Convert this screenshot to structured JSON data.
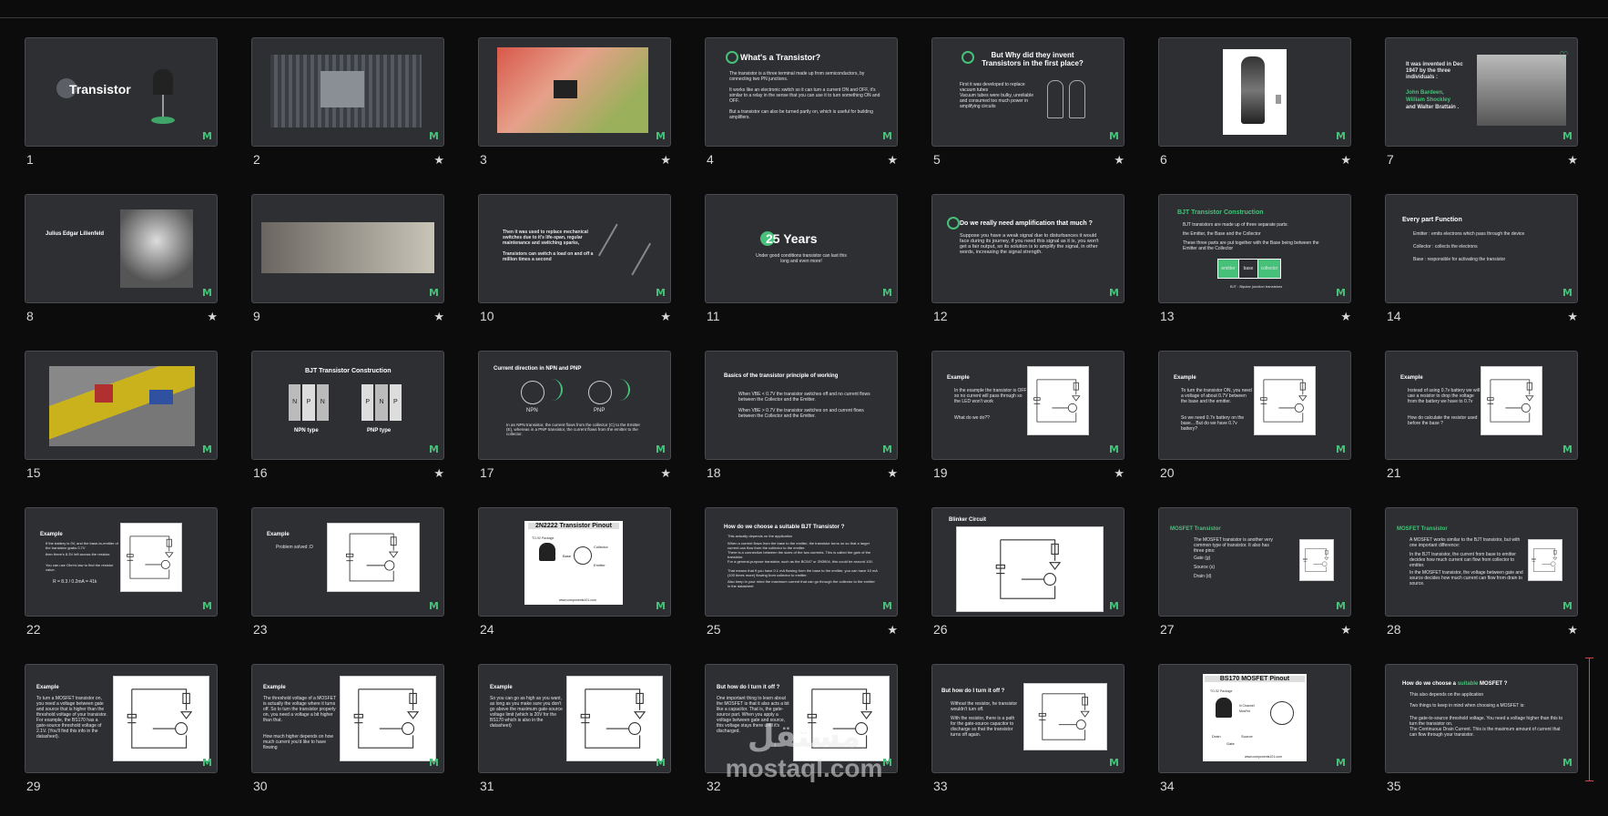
{
  "slides": [
    {
      "n": "1",
      "starred": false,
      "title": "Transistor"
    },
    {
      "n": "2",
      "starred": true
    },
    {
      "n": "3",
      "starred": true
    },
    {
      "n": "4",
      "starred": true,
      "title": "What's a Transistor?",
      "lines": [
        "The transistor is a three terminal made up from semiconductors, by connecting two PN junctions.",
        "It works like an electronic switch so it can turn a current ON and OFF, it's similar to a relay in the sense that you can use it to turn something ON and OFF.",
        "But a transistor can also be turned partly on, which is useful for building amplifiers."
      ]
    },
    {
      "n": "5",
      "starred": true,
      "title": "But Why did they invent Transistors in the first place?",
      "lines": [
        "First it was developed to replace vacuum tubes",
        "Vacuum tubes were bulky, unreliable and consumed too much power in amplifying circuits"
      ]
    },
    {
      "n": "6",
      "starred": true
    },
    {
      "n": "7",
      "starred": true,
      "lines": [
        "It was invented in Dec 1947 by the three individuals :",
        "John Bardeen,",
        "William Shockley",
        "and Walter Brattain ."
      ]
    },
    {
      "n": "8",
      "starred": true,
      "title": "Julius Edgar Lilienfeld"
    },
    {
      "n": "9",
      "starred": true
    },
    {
      "n": "10",
      "starred": true,
      "lines": [
        "Then it was used to replace mechanical switches due to it's life-span, regular maintenance and switching sparks, ",
        "Transistors can switch a load on and off a million times a second"
      ]
    },
    {
      "n": "11",
      "starred": false,
      "title": "25 Years",
      "lines": [
        "Under good conditions transistor can last this long and even more!"
      ]
    },
    {
      "n": "12",
      "starred": false,
      "title": "Do we really need amplification that much ?",
      "lines": [
        "Suppose you have a weak signal due to disturbances it would face during its journey, if you need this signal as it is, you won't get a fair output, so its solution is to amplify the signal, in other words, increasing the signal strength."
      ]
    },
    {
      "n": "13",
      "starred": true,
      "title": "BJT Transistor Construction",
      "lines": [
        "BJT transistors are made up of three separate parts:",
        "the Emitter, the Base and the Collector",
        "These three parts are put together with the Base being between the Emitter and the Collector",
        "emitter",
        "base",
        "collector",
        "BJT : Bipolar junction transistors"
      ]
    },
    {
      "n": "14",
      "starred": true,
      "title": "Every part Function",
      "lines": [
        "Emitter : emits electrons which pass through the device",
        "Collector : collects the electrons",
        "Base : responsible for activating the transistor"
      ]
    },
    {
      "n": "15",
      "starred": false
    },
    {
      "n": "16",
      "starred": true,
      "title": "BJT Transistor Construction",
      "lines": [
        "NPN type",
        "PNP type"
      ]
    },
    {
      "n": "17",
      "starred": true,
      "title": "Current direction in NPN and PNP",
      "lines": [
        "NPN",
        "PNP",
        "In an NPN transistor, the current flows from the collector (C) to the Emitter (E), whereas in a PNP transistor, the current flows from the emitter to the collector."
      ]
    },
    {
      "n": "18",
      "starred": true,
      "title": "Basics of the transistor principle of working",
      "lines": [
        "When VBE < 0.7V the transistor switches off and no current flows between the Collector and the Emitter.",
        "When VBE > 0.7V the transistor switches on and current flows between the Collector and the Emitter."
      ]
    },
    {
      "n": "19",
      "starred": true,
      "title": "Example",
      "lines": [
        "In the example the transistor is OFF so no current will pass through so the LED won't work",
        "What do we do??"
      ]
    },
    {
      "n": "20",
      "starred": false,
      "title": "Example",
      "lines": [
        "To turn the transistor ON, you need a voltage of about 0.7V between the base and the emitter.",
        "So we need 0.7v battery on the base... But do we have 0.7v battery?"
      ]
    },
    {
      "n": "21",
      "starred": false,
      "title": "Example",
      "lines": [
        "Instead of using 0.7v battery we will use a resistor to drop the voltage from the battery we have to 0.7v",
        "How do calculate the resistor used before the base ?"
      ]
    },
    {
      "n": "22",
      "starred": false,
      "title": "Example",
      "lines": [
        "If the battery is 9V, and the base-to-emitter of the transistor grabs 0.7V",
        "then there's 8.3V left across the resistor.",
        "You can use Ohm's law to find the resistor value.",
        "R = 8.3 / 0.2mA = 41k"
      ]
    },
    {
      "n": "23",
      "starred": false,
      "title": "Example",
      "lines": [
        "Problem solved :D"
      ]
    },
    {
      "n": "24",
      "starred": false,
      "title": "2N2222 Transistor Pinout",
      "lines": [
        "TO-92 Package",
        "Collector",
        "Base",
        "Emitter",
        "www.components101.com"
      ]
    },
    {
      "n": "25",
      "starred": true,
      "title": "How do we choose a suitable BJT Transistor ?",
      "lines": [
        "This actually depends on the application",
        "When a current flows from the base to the emitter, the transistor turns on so that a larger current can flow from the collector to the emitter.",
        "There is a connection between the sizes of the two currents. This is called the gain of the transistor.",
        "For a general-purpose transistor, such as the BC547 or 2N3904, this could be around 100.",
        "That means that if you have 0.1 mA flowing from the base to the emitter, you can have 10 mA (100 times more) flowing from collector to emitter.",
        "Also keep in your mind the maximum current that can go through the collector to the emitter in the datasheet"
      ]
    },
    {
      "n": "26",
      "starred": false,
      "title": "Blinker Circuit"
    },
    {
      "n": "27",
      "starred": true,
      "title": "MOSFET Transistor",
      "lines": [
        "The MOSFET transistor is another very common type of transistor. It also has three pins:",
        "Gate (g)",
        "Source (s)",
        "Drain (d)"
      ]
    },
    {
      "n": "28",
      "starred": true,
      "title": "MOSFET Transistor",
      "lines": [
        "A MOSFET works similar to the BJT transistor, but with one important difference:",
        "In the BJT transistor, the current from base to emitter decides how much current can flow from collector to emitter.",
        "In the MOSFET transistor, the voltage between gate and source decides how much current can flow from drain to source."
      ]
    },
    {
      "n": "29",
      "starred": false,
      "title": "Example",
      "lines": [
        "To turn a MOSFET transistor on, you need a voltage between gate and source that is higher than the threshold voltage of your transistor. For example, the BS170 has a gate-source threshold voltage of 2.1V. (You'll find this info in the datasheet)."
      ]
    },
    {
      "n": "30",
      "starred": false,
      "title": "Example",
      "lines": [
        "The threshold voltage of a MOSFET is actually the voltage where it turns off. So to turn the transistor properly on, you need a voltage a bit higher than that.",
        "How much higher depends on how much current you'd like to have flowing"
      ]
    },
    {
      "n": "31",
      "starred": false,
      "title": "Example",
      "lines": [
        "So you can go as high as you want, as long as you make sure you don't go above the maximum gate-source voltage limit (which is 20V for the BS170 which is also in the datasheet)"
      ]
    },
    {
      "n": "32",
      "starred": false,
      "title": "But how do I turn it off ?",
      "lines": [
        "One important thing to learn about the MOSFET is that it also acts a bit like a capacitor. That is, the gate-source part. When you apply a voltage between gate and source, this voltage stays there until it's discharged."
      ]
    },
    {
      "n": "33",
      "starred": false,
      "title": "But how do I turn it off ?",
      "lines": [
        "Without the resistor, he transistor wouldn't turn off.",
        "With the resistor, there is a path for the gate-source capacitor to discharge so that the transistor turns off again."
      ]
    },
    {
      "n": "34",
      "starred": false,
      "title": "BS170 MOSFET Pinout",
      "lines": [
        "TO-92 Package",
        "N Channel MosFet",
        "Drain",
        "Gate",
        "Source",
        "www.components101.com"
      ]
    },
    {
      "n": "35",
      "starred": false,
      "title": "How do we choose a suitable MOSFET ?",
      "lines": [
        "This also depends on the application",
        "Two things to keep in mind when choosing a MOSFET is:",
        "The gate-to-source threshold voltage. You need a voltage higher than this to turn the transistor on.",
        "The Continuous Drain Current. This is the maximum amount of current that can flow through your transistor."
      ]
    }
  ],
  "logo_text": "M",
  "star_glyph": "★",
  "watermark": {
    "arabic": "مستقل",
    "latin": "mostaql.com"
  },
  "colors": {
    "background": "#0c0c0d",
    "slide": "#2e2f33",
    "accent": "#47c17a"
  }
}
